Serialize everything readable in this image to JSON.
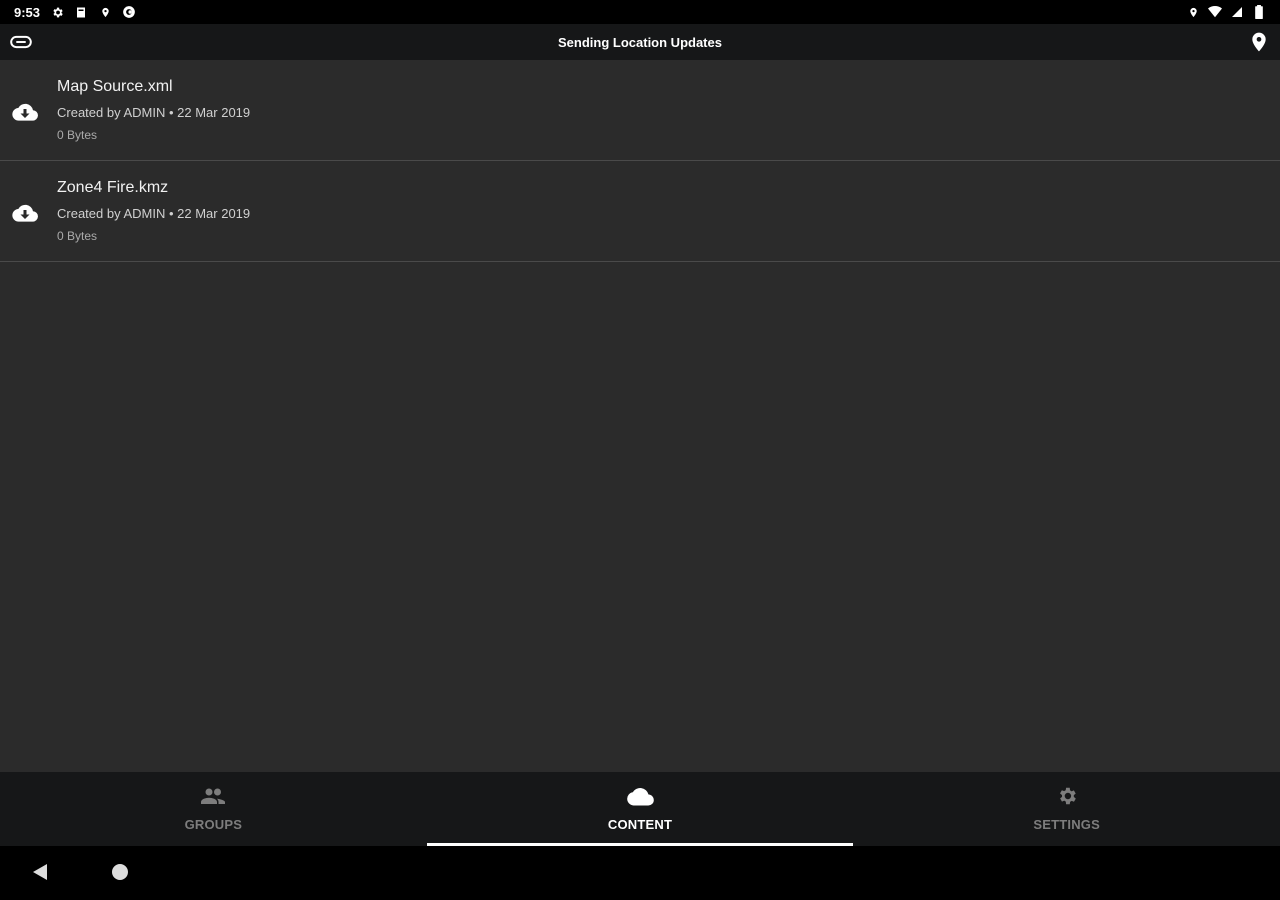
{
  "status_bar": {
    "time": "9:53",
    "left_icons": [
      "gear-icon",
      "sd-card-icon",
      "location-icon",
      "app-icon"
    ],
    "right_icons": [
      "location-icon",
      "wifi-icon",
      "signal-icon",
      "battery-icon"
    ]
  },
  "app_bar": {
    "title": "Sending Location Updates",
    "left_icon": "link-icon",
    "right_icon": "map-pin-icon"
  },
  "content": {
    "items": [
      {
        "title": "Map Source.xml",
        "subtitle": "Created by ADMIN • 22 Mar 2019",
        "size": "0 Bytes",
        "icon": "cloud-download-icon"
      },
      {
        "title": "Zone4 Fire.kmz",
        "subtitle": "Created by ADMIN • 22 Mar 2019",
        "size": "0 Bytes",
        "icon": "cloud-download-icon"
      }
    ]
  },
  "bottom_nav": {
    "tabs": [
      {
        "label": "GROUPS",
        "icon": "groups-icon",
        "active": false
      },
      {
        "label": "CONTENT",
        "icon": "cloud-icon",
        "active": true
      },
      {
        "label": "SETTINGS",
        "icon": "gear-icon",
        "active": false
      }
    ]
  },
  "colors": {
    "background": "#2b2b2b",
    "bar": "#161718",
    "system": "#000000",
    "active": "#ffffff",
    "inactive": "#7d7d7d"
  }
}
